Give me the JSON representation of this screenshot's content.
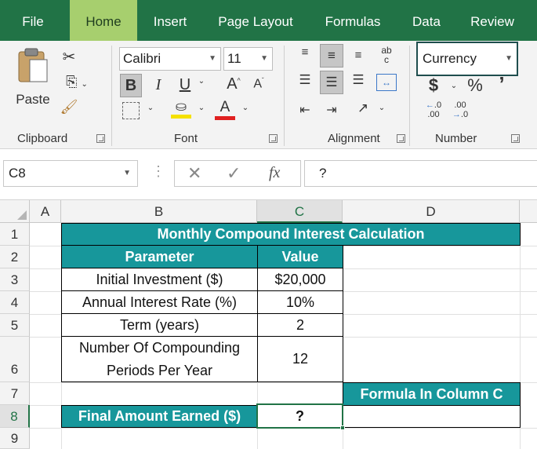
{
  "tabs": [
    "File",
    "Home",
    "Insert",
    "Page Layout",
    "Formulas",
    "Data",
    "Review"
  ],
  "clipboard": {
    "paste_label": "Paste",
    "group_label": "Clipboard"
  },
  "font": {
    "name": "Calibri",
    "size": "11",
    "group_label": "Font",
    "bold": "B",
    "italic": "I",
    "underline": "U"
  },
  "alignment": {
    "group_label": "Alignment"
  },
  "number": {
    "format": "Currency",
    "group_label": "Number",
    "dollar": "$",
    "percent": "%",
    "comma": "’"
  },
  "formula_bar": {
    "name_box": "C8",
    "fx_label": "fx",
    "content": "?"
  },
  "columns": [
    "A",
    "B",
    "C",
    "D"
  ],
  "rows": [
    "1",
    "2",
    "3",
    "4",
    "5",
    "6",
    "7",
    "8",
    "9"
  ],
  "sheet": {
    "title": "Monthly Compound Interest Calculation",
    "hdr_param": "Parameter",
    "hdr_value": "Value",
    "r3_label": "Initial Investment ($)",
    "r3_value": "$20,000",
    "r4_label": "Annual Interest Rate (%)",
    "r4_value": "10%",
    "r5_label": "Term (years)",
    "r5_value": "2",
    "r6_label_line1": "Number Of Compounding",
    "r6_label_line2": "Periods Per Year",
    "r6_value": "12",
    "formula_hdr": "Formula In Column C",
    "final_label": "Final Amount Earned ($)",
    "final_value": "?",
    "final_formula": ""
  },
  "colors": {
    "accent": "#217346",
    "home_tab": "#a7cf6e",
    "teal": "#17979b"
  }
}
